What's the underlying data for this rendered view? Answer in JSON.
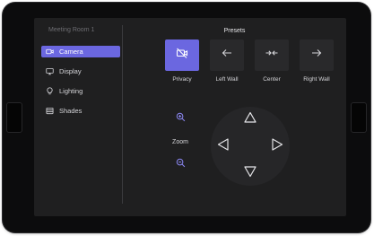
{
  "app": {
    "room_title": "Meeting Room 1"
  },
  "sidebar": {
    "items": [
      {
        "label": "Camera",
        "icon": "camera-icon",
        "active": true
      },
      {
        "label": "Display",
        "icon": "monitor-icon",
        "active": false
      },
      {
        "label": "Lighting",
        "icon": "lightbulb-icon",
        "active": false
      },
      {
        "label": "Shades",
        "icon": "shades-icon",
        "active": false
      }
    ]
  },
  "presets": {
    "heading": "Presets",
    "items": [
      {
        "label": "Privacy",
        "icon": "camera-off-icon",
        "active": true
      },
      {
        "label": "Left Wall",
        "icon": "arrow-left-icon",
        "active": false
      },
      {
        "label": "Center",
        "icon": "arrows-center-icon",
        "active": false
      },
      {
        "label": "Right Wall",
        "icon": "arrow-right-icon",
        "active": false
      }
    ]
  },
  "zoom": {
    "label": "Zoom",
    "zoom_in_icon": "zoom-in-icon",
    "zoom_out_icon": "zoom-out-icon"
  },
  "ptz": {
    "up_icon": "triangle-up-icon",
    "down_icon": "triangle-down-icon",
    "left_icon": "triangle-left-icon",
    "right_icon": "triangle-right-icon"
  },
  "colors": {
    "accent": "#6b67e0",
    "screen_bg": "#1f1f20",
    "tile_bg": "#29292b",
    "text": "#d4d4d8",
    "muted": "#6d6d72"
  }
}
